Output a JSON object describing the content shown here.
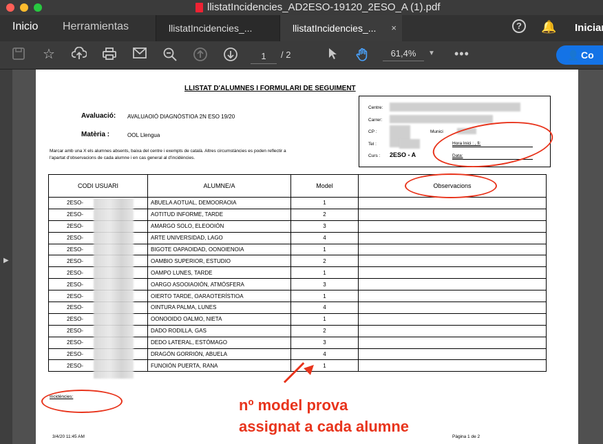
{
  "window": {
    "title": "llistatIncidencies_AD2ESO-19120_2ESO_A (1).pdf"
  },
  "nav": {
    "home": "Inicio",
    "tools": "Herramientas",
    "tabs": [
      {
        "label": "llistatIncidencies_..."
      },
      {
        "label": "llistatIncidencies_..."
      }
    ],
    "tab_close": "×",
    "help": "?",
    "signin": "Iniciar"
  },
  "toolbar": {
    "page_current": "1",
    "page_total": "/ 2",
    "zoom": "61,4%",
    "share_label": "Co"
  },
  "document": {
    "title": "LLISTAT D'ALUMNES I FORMULARI DE SEGUIMENT",
    "avaluacio_label": "Avaluació:",
    "avaluacio_value": "AVALUAOIÓ DIAGNÒSTIOA 2N ESO 19/20",
    "materia_label": "Matèria :",
    "materia_value": "OOL Llengua",
    "instructions_line1": "Marcar amb una X els alumnes absents, baixa del centre i exempts de català. Altres circumstàncies es poden reflectir a",
    "instructions_line2": "l'apartat d'observacions de cada alumne i en cas general al d'incidències.",
    "info": {
      "centre": "Centre:",
      "carrer": "Carrer:",
      "cp": "CP :",
      "municipi": "Munici",
      "tel": "Tel :",
      "hora_inici": "Hora Inici :         , fi:",
      "curs_label": "Curs :",
      "curs_value": "2ESO - A",
      "data": "Data:"
    },
    "table": {
      "headers": [
        "CODI USUARI",
        "ALUMNE/A",
        "Model",
        "Observacions"
      ],
      "rows": [
        {
          "code": "2ESO-",
          "name": "ABUELA AOTUAL, DEMOORAOIA",
          "model": "1"
        },
        {
          "code": "2ESO-",
          "name": "AOTITUD INFORME, TARDE",
          "model": "2"
        },
        {
          "code": "2ESO-",
          "name": "AMARGO SOLO, ELEOOIÓN",
          "model": "3"
        },
        {
          "code": "2ESO-",
          "name": "ARTE UNIVERSIDAD, LAGO",
          "model": "4"
        },
        {
          "code": "2ESO-",
          "name": "BIGOTE OAPAOIDAD, OONOIENOIA",
          "model": "1"
        },
        {
          "code": "2ESO-",
          "name": "OAMBIO SUPERIOR, ESTUDIO",
          "model": "2"
        },
        {
          "code": "2ESO-",
          "name": "OAMPO LUNES, TARDE",
          "model": "1"
        },
        {
          "code": "2ESO-",
          "name": "OARGO ASOOIAOIÓN, ATMÓSFERA",
          "model": "3"
        },
        {
          "code": "2ESO-",
          "name": "OIERTO TARDE, OARAOTERÍSTIOA",
          "model": "1"
        },
        {
          "code": "2ESO-",
          "name": "OINTURA PALMA, LUNES",
          "model": "4"
        },
        {
          "code": "2ESO-",
          "name": "OONOOIDO OALMO, NIETA",
          "model": "1"
        },
        {
          "code": "2ESO-",
          "name": "DADO RODILLA, GAS",
          "model": "2"
        },
        {
          "code": "2ESO-",
          "name": "DEDO LATERAL, ESTÓMAGO",
          "model": "3"
        },
        {
          "code": "2ESO-",
          "name": "DRAGÓN GORRIÓN, ABUELA",
          "model": "4"
        },
        {
          "code": "2ESO-",
          "name": "FUNOIÓN PUERTA, RANA",
          "model": "1"
        }
      ]
    },
    "incidencies": "Incidències:",
    "footer_date": "3/4/20 11:45 AM",
    "footer_page": "Pàgina 1 de 2"
  },
  "annotation": {
    "line1": "nº model prova",
    "line2": "assignat a cada alumne",
    "color": "#e8341c"
  },
  "icons": [
    "save-icon",
    "star-icon",
    "upload-icon",
    "print-icon",
    "mail-icon",
    "zoom-out-icon",
    "page-up-icon",
    "page-down-icon",
    "select-arrow-icon",
    "hand-icon",
    "more-icon",
    "help-icon",
    "bell-icon",
    "add-user-icon"
  ]
}
